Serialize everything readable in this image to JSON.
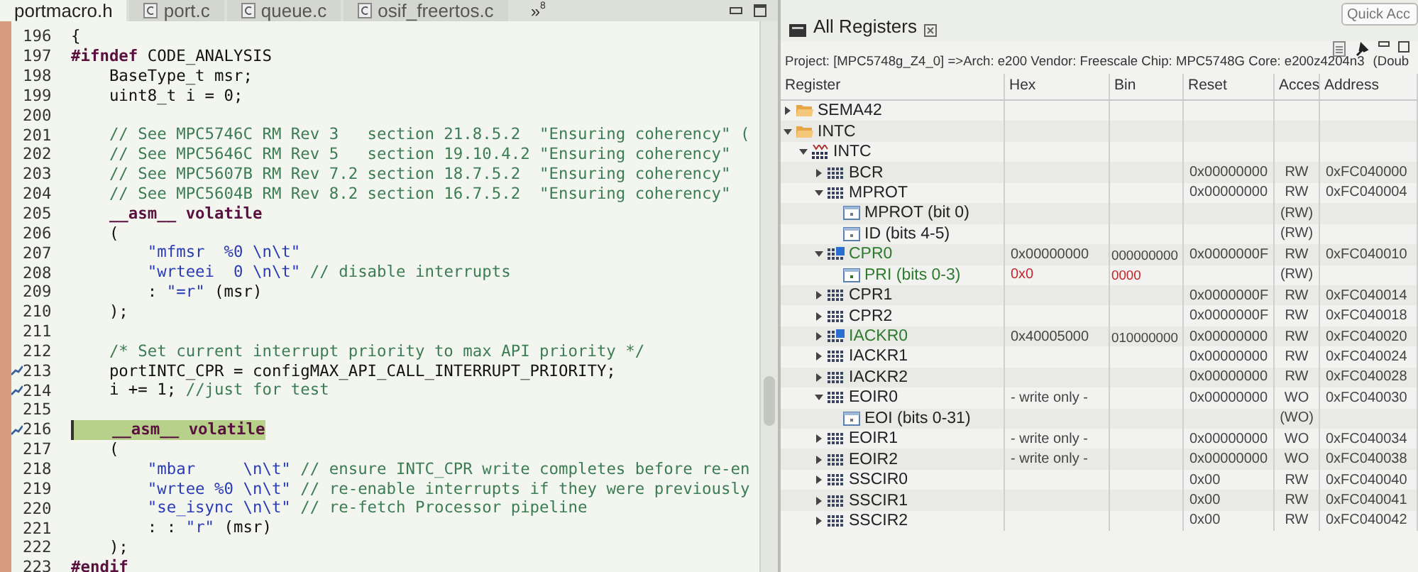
{
  "editor": {
    "tabs": [
      {
        "label": "portmacro.h",
        "kind": "header",
        "selected": true
      },
      {
        "label": "port.c",
        "kind": "c",
        "selected": false
      },
      {
        "label": "queue.c",
        "kind": "c",
        "selected": false
      },
      {
        "label": "osif_freertos.c",
        "kind": "c",
        "selected": false
      }
    ],
    "overflow": {
      "symbol": "»",
      "count": "8"
    },
    "lines": [
      {
        "number": "196",
        "marker": false,
        "highlighted": false,
        "segments": [
          {
            "kind": "plain",
            "text": "{"
          }
        ]
      },
      {
        "number": "197",
        "marker": false,
        "highlighted": false,
        "segments": [
          {
            "kind": "keyword",
            "text": "#ifndef"
          },
          {
            "kind": "plain",
            "text": " CODE_ANALYSIS"
          }
        ]
      },
      {
        "number": "198",
        "marker": false,
        "highlighted": false,
        "segments": [
          {
            "kind": "plain",
            "text": "    BaseType_t msr;"
          }
        ]
      },
      {
        "number": "199",
        "marker": false,
        "highlighted": false,
        "segments": [
          {
            "kind": "plain",
            "text": "    uint8_t i = 0;"
          }
        ]
      },
      {
        "number": "200",
        "marker": false,
        "highlighted": false
      },
      {
        "number": "201",
        "marker": false,
        "highlighted": false,
        "segments": [
          {
            "kind": "comment",
            "text": "    // See MPC5746C RM Rev 3   section 21.8.5.2  \"Ensuring coherency\" ("
          }
        ]
      },
      {
        "number": "202",
        "marker": false,
        "highlighted": false,
        "segments": [
          {
            "kind": "comment",
            "text": "    // See MPC5646C RM Rev 5   section 19.10.4.2 \"Ensuring coherency\""
          }
        ]
      },
      {
        "number": "203",
        "marker": false,
        "highlighted": false,
        "segments": [
          {
            "kind": "comment",
            "text": "    // See MPC5607B RM Rev 7.2 section 18.7.5.2  \"Ensuring coherency\""
          }
        ]
      },
      {
        "number": "204",
        "marker": false,
        "highlighted": false,
        "segments": [
          {
            "kind": "comment",
            "text": "    // See MPC5604B RM Rev 8.2 section 16.7.5.2  \"Ensuring coherency\""
          }
        ]
      },
      {
        "number": "205",
        "marker": false,
        "highlighted": false,
        "segments": [
          {
            "kind": "keyword",
            "text": "    __asm__ volatile"
          }
        ]
      },
      {
        "number": "206",
        "marker": false,
        "highlighted": false,
        "segments": [
          {
            "kind": "plain",
            "text": "    ("
          }
        ]
      },
      {
        "number": "207",
        "marker": false,
        "highlighted": false,
        "segments": [
          {
            "kind": "string",
            "text": "        \"mfmsr  %0 \\n\\t\""
          }
        ]
      },
      {
        "number": "208",
        "marker": false,
        "highlighted": false,
        "segments": [
          {
            "kind": "string",
            "text": "        \"wrteei  0 \\n\\t\""
          },
          {
            "kind": "comment",
            "text": " // disable interrupts"
          }
        ]
      },
      {
        "number": "209",
        "marker": false,
        "highlighted": false,
        "segments": [
          {
            "kind": "plain",
            "text": "        : "
          },
          {
            "kind": "string",
            "text": "\"=r\""
          },
          {
            "kind": "plain",
            "text": " (msr)"
          }
        ]
      },
      {
        "number": "210",
        "marker": false,
        "highlighted": false,
        "segments": [
          {
            "kind": "plain",
            "text": "    );"
          }
        ]
      },
      {
        "number": "211",
        "marker": false,
        "highlighted": false
      },
      {
        "number": "212",
        "marker": false,
        "highlighted": false,
        "segments": [
          {
            "kind": "comment",
            "text": "    /* Set current interrupt priority to max API priority */"
          }
        ]
      },
      {
        "number": "213",
        "marker": true,
        "highlighted": false,
        "segments": [
          {
            "kind": "plain",
            "text": "    portINTC_CPR = configMAX_API_CALL_INTERRUPT_PRIORITY;"
          }
        ]
      },
      {
        "number": "214",
        "marker": true,
        "highlighted": false,
        "segments": [
          {
            "kind": "plain",
            "text": "    i += 1; "
          },
          {
            "kind": "comment",
            "text": "//just for test"
          }
        ]
      },
      {
        "number": "215",
        "marker": false,
        "highlighted": false
      },
      {
        "number": "216",
        "marker": true,
        "highlighted": true,
        "segments": [
          {
            "kind": "keyword",
            "text": "    __asm__ volatile"
          }
        ]
      },
      {
        "number": "217",
        "marker": false,
        "highlighted": false,
        "segments": [
          {
            "kind": "plain",
            "text": "    ("
          }
        ]
      },
      {
        "number": "218",
        "marker": false,
        "highlighted": false,
        "segments": [
          {
            "kind": "string",
            "text": "        \"mbar     \\n\\t\""
          },
          {
            "kind": "comment",
            "text": " // ensure INTC_CPR write completes before re-en"
          }
        ]
      },
      {
        "number": "219",
        "marker": false,
        "highlighted": false,
        "segments": [
          {
            "kind": "string",
            "text": "        \"wrtee %0 \\n\\t\""
          },
          {
            "kind": "comment",
            "text": " // re-enable interrupts if they were previously"
          }
        ]
      },
      {
        "number": "220",
        "marker": false,
        "highlighted": false,
        "segments": [
          {
            "kind": "string",
            "text": "        \"se_isync \\n\\t\""
          },
          {
            "kind": "comment",
            "text": " // re-fetch Processor pipeline"
          }
        ]
      },
      {
        "number": "221",
        "marker": false,
        "highlighted": false,
        "segments": [
          {
            "kind": "plain",
            "text": "        : : "
          },
          {
            "kind": "string",
            "text": "\"r\""
          },
          {
            "kind": "plain",
            "text": " (msr)"
          }
        ]
      },
      {
        "number": "222",
        "marker": false,
        "highlighted": false,
        "segments": [
          {
            "kind": "plain",
            "text": "    );"
          }
        ]
      },
      {
        "number": "223",
        "marker": false,
        "highlighted": false,
        "segments": [
          {
            "kind": "keyword",
            "text": "#endif"
          }
        ]
      }
    ]
  },
  "quick_access": {
    "placeholder": "Quick Acc"
  },
  "registers": {
    "title": "All Registers",
    "project": "Project: [MPC5748g_Z4_0] =>Arch: e200 Vendor: Freescale Chip: MPC5748G Core: e200z4204n3",
    "project_suffix": "(Doub",
    "columns": [
      "Register",
      "Hex",
      "Bin",
      "Reset",
      "Acces",
      "Address"
    ],
    "rows": [
      {
        "kind": "folder",
        "name": "SEMA42",
        "expanded": false,
        "changed": false
      },
      {
        "kind": "folder",
        "name": "INTC",
        "expanded": true,
        "changed": false,
        "children": [
          {
            "kind": "peripheral",
            "name": "INTC",
            "expanded": true,
            "changed": false,
            "children": [
              {
                "kind": "register",
                "name": "BCR",
                "expanded": false,
                "changed": false,
                "reset": "0x00000000",
                "access": "RW",
                "address": "0xFC040000"
              },
              {
                "kind": "register",
                "name": "MPROT",
                "expanded": true,
                "changed": false,
                "reset": "0x00000000",
                "access": "RW",
                "address": "0xFC040004",
                "children": [
                  {
                    "kind": "field",
                    "name": "MPROT (bit 0)",
                    "changed": false,
                    "access": "(RW)"
                  },
                  {
                    "kind": "field",
                    "name": "ID (bits 4-5)",
                    "changed": false,
                    "access": "(RW)"
                  }
                ]
              },
              {
                "kind": "register",
                "name": "CPR0",
                "expanded": true,
                "changed": true,
                "hex": "0x00000000",
                "bin": "000000000",
                "reset": "0x0000000F",
                "access": "RW",
                "address": "0xFC040010",
                "children": [
                  {
                    "kind": "field",
                    "name": "PRI (bits 0-3)",
                    "changed": true,
                    "hex": "0x0",
                    "bin": "0000",
                    "access": "(RW)"
                  }
                ]
              },
              {
                "kind": "register",
                "name": "CPR1",
                "expanded": false,
                "changed": false,
                "reset": "0x0000000F",
                "access": "RW",
                "address": "0xFC040014"
              },
              {
                "kind": "register",
                "name": "CPR2",
                "expanded": false,
                "changed": false,
                "reset": "0x0000000F",
                "access": "RW",
                "address": "0xFC040018"
              },
              {
                "kind": "register",
                "name": "IACKR0",
                "expanded": false,
                "changed": true,
                "hex": "0x40005000",
                "bin": "010000000",
                "reset": "0x00000000",
                "access": "RW",
                "address": "0xFC040020"
              },
              {
                "kind": "register",
                "name": "IACKR1",
                "expanded": false,
                "changed": false,
                "reset": "0x00000000",
                "access": "RW",
                "address": "0xFC040024"
              },
              {
                "kind": "register",
                "name": "IACKR2",
                "expanded": false,
                "changed": false,
                "reset": "0x00000000",
                "access": "RW",
                "address": "0xFC040028"
              },
              {
                "kind": "register",
                "name": "EOIR0",
                "expanded": true,
                "changed": false,
                "hex": "- write only -",
                "reset": "0x00000000",
                "access": "WO",
                "address": "0xFC040030",
                "children": [
                  {
                    "kind": "field",
                    "name": "EOI (bits 0-31)",
                    "changed": false,
                    "access": "(WO)"
                  }
                ]
              },
              {
                "kind": "register",
                "name": "EOIR1",
                "expanded": false,
                "changed": false,
                "hex": "- write only -",
                "reset": "0x00000000",
                "access": "WO",
                "address": "0xFC040034"
              },
              {
                "kind": "register",
                "name": "EOIR2",
                "expanded": false,
                "changed": false,
                "hex": "- write only -",
                "reset": "0x00000000",
                "access": "WO",
                "address": "0xFC040038"
              },
              {
                "kind": "register",
                "name": "SSCIR0",
                "expanded": false,
                "changed": false,
                "reset": "0x00",
                "access": "RW",
                "address": "0xFC040040"
              },
              {
                "kind": "register",
                "name": "SSCIR1",
                "expanded": false,
                "changed": false,
                "reset": "0x00",
                "access": "RW",
                "address": "0xFC040041"
              },
              {
                "kind": "register",
                "name": "SSCIR2",
                "expanded": false,
                "changed": false,
                "reset": "0x00",
                "access": "RW",
                "address": "0xFC040042"
              }
            ]
          }
        ]
      }
    ]
  }
}
